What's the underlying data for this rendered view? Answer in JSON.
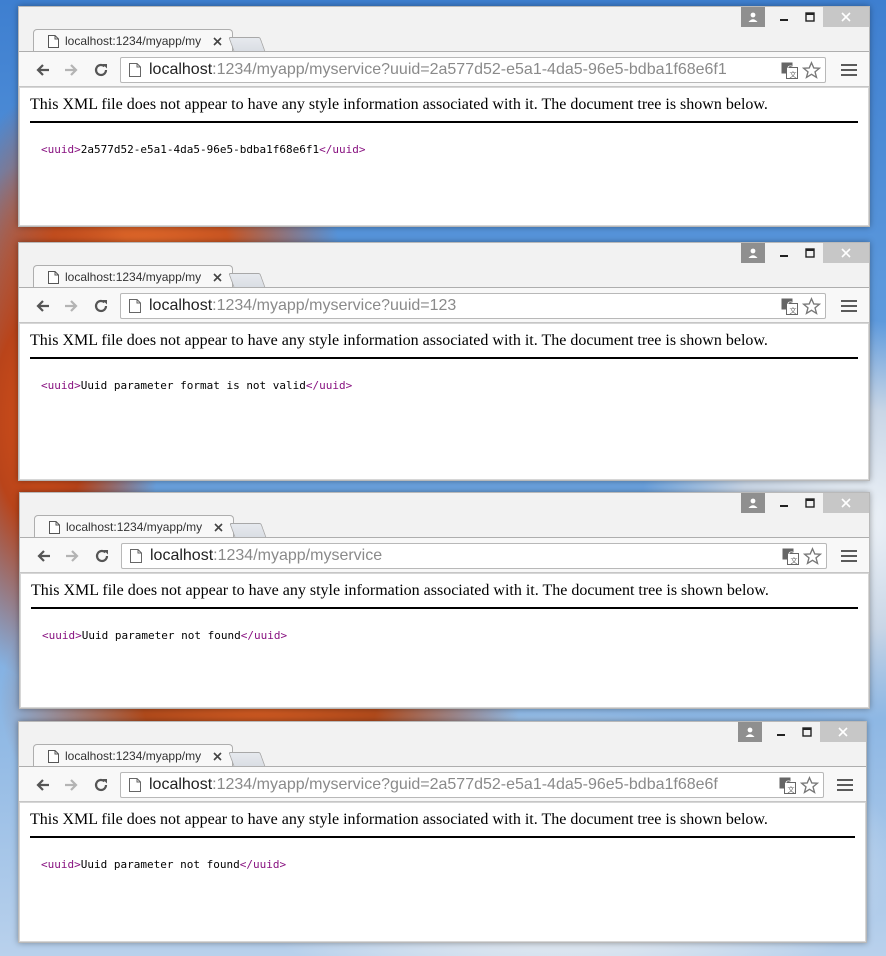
{
  "windows": [
    {
      "tab_title": "localhost:1234/myapp/my",
      "url_host": "localhost",
      "url_path": ":1234/myapp/myservice?uuid=2a577d52-e5a1-4da5-96e5-bdba1f68e6f1",
      "xml_notice": "This XML file does not appear to have any style information associated with it. The document tree is shown below.",
      "open_tag": "<uuid>",
      "value": "2a577d52-e5a1-4da5-96e5-bdba1f68e6f1",
      "close_tag": "</uuid>"
    },
    {
      "tab_title": "localhost:1234/myapp/my",
      "url_host": "localhost",
      "url_path": ":1234/myapp/myservice?uuid=123",
      "xml_notice": "This XML file does not appear to have any style information associated with it. The document tree is shown below.",
      "open_tag": "<uuid>",
      "value": "Uuid parameter format is not valid",
      "close_tag": "</uuid>"
    },
    {
      "tab_title": "localhost:1234/myapp/my",
      "url_host": "localhost",
      "url_path": ":1234/myapp/myservice",
      "xml_notice": "This XML file does not appear to have any style information associated with it. The document tree is shown below.",
      "open_tag": "<uuid>",
      "value": "Uuid parameter not found",
      "close_tag": "</uuid>"
    },
    {
      "tab_title": "localhost:1234/myapp/my",
      "url_host": "localhost",
      "url_path": ":1234/myapp/myservice?guid=2a577d52-e5a1-4da5-96e5-bdba1f68e6f",
      "xml_notice": "This XML file does not appear to have any style information associated with it. The document tree is shown below.",
      "open_tag": "<uuid>",
      "value": "Uuid parameter not found",
      "close_tag": "</uuid>"
    }
  ],
  "colors": {
    "xml_tag": "#881280",
    "url_path": "#8a8a8a",
    "close_button_bg": "#c7c7c7",
    "user_button_bg": "#8f8f8f"
  },
  "icons": [
    "user-icon",
    "minimize-icon",
    "maximize-icon",
    "close-icon",
    "page-icon",
    "tab-close-icon",
    "back-icon",
    "forward-icon",
    "reload-icon",
    "translate-icon",
    "star-icon",
    "menu-icon"
  ]
}
